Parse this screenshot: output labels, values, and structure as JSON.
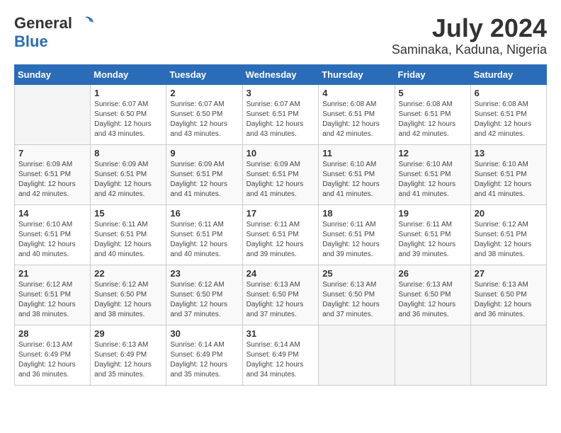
{
  "header": {
    "logo_general": "General",
    "logo_blue": "Blue",
    "title": "July 2024",
    "subtitle": "Saminaka, Kaduna, Nigeria"
  },
  "calendar": {
    "days_of_week": [
      "Sunday",
      "Monday",
      "Tuesday",
      "Wednesday",
      "Thursday",
      "Friday",
      "Saturday"
    ],
    "weeks": [
      [
        {
          "day": "",
          "sunrise": "",
          "sunset": "",
          "daylight": ""
        },
        {
          "day": "1",
          "sunrise": "Sunrise: 6:07 AM",
          "sunset": "Sunset: 6:50 PM",
          "daylight": "Daylight: 12 hours and 43 minutes."
        },
        {
          "day": "2",
          "sunrise": "Sunrise: 6:07 AM",
          "sunset": "Sunset: 6:50 PM",
          "daylight": "Daylight: 12 hours and 43 minutes."
        },
        {
          "day": "3",
          "sunrise": "Sunrise: 6:07 AM",
          "sunset": "Sunset: 6:51 PM",
          "daylight": "Daylight: 12 hours and 43 minutes."
        },
        {
          "day": "4",
          "sunrise": "Sunrise: 6:08 AM",
          "sunset": "Sunset: 6:51 PM",
          "daylight": "Daylight: 12 hours and 42 minutes."
        },
        {
          "day": "5",
          "sunrise": "Sunrise: 6:08 AM",
          "sunset": "Sunset: 6:51 PM",
          "daylight": "Daylight: 12 hours and 42 minutes."
        },
        {
          "day": "6",
          "sunrise": "Sunrise: 6:08 AM",
          "sunset": "Sunset: 6:51 PM",
          "daylight": "Daylight: 12 hours and 42 minutes."
        }
      ],
      [
        {
          "day": "7",
          "sunrise": "Sunrise: 6:09 AM",
          "sunset": "Sunset: 6:51 PM",
          "daylight": "Daylight: 12 hours and 42 minutes."
        },
        {
          "day": "8",
          "sunrise": "Sunrise: 6:09 AM",
          "sunset": "Sunset: 6:51 PM",
          "daylight": "Daylight: 12 hours and 42 minutes."
        },
        {
          "day": "9",
          "sunrise": "Sunrise: 6:09 AM",
          "sunset": "Sunset: 6:51 PM",
          "daylight": "Daylight: 12 hours and 41 minutes."
        },
        {
          "day": "10",
          "sunrise": "Sunrise: 6:09 AM",
          "sunset": "Sunset: 6:51 PM",
          "daylight": "Daylight: 12 hours and 41 minutes."
        },
        {
          "day": "11",
          "sunrise": "Sunrise: 6:10 AM",
          "sunset": "Sunset: 6:51 PM",
          "daylight": "Daylight: 12 hours and 41 minutes."
        },
        {
          "day": "12",
          "sunrise": "Sunrise: 6:10 AM",
          "sunset": "Sunset: 6:51 PM",
          "daylight": "Daylight: 12 hours and 41 minutes."
        },
        {
          "day": "13",
          "sunrise": "Sunrise: 6:10 AM",
          "sunset": "Sunset: 6:51 PM",
          "daylight": "Daylight: 12 hours and 41 minutes."
        }
      ],
      [
        {
          "day": "14",
          "sunrise": "Sunrise: 6:10 AM",
          "sunset": "Sunset: 6:51 PM",
          "daylight": "Daylight: 12 hours and 40 minutes."
        },
        {
          "day": "15",
          "sunrise": "Sunrise: 6:11 AM",
          "sunset": "Sunset: 6:51 PM",
          "daylight": "Daylight: 12 hours and 40 minutes."
        },
        {
          "day": "16",
          "sunrise": "Sunrise: 6:11 AM",
          "sunset": "Sunset: 6:51 PM",
          "daylight": "Daylight: 12 hours and 40 minutes."
        },
        {
          "day": "17",
          "sunrise": "Sunrise: 6:11 AM",
          "sunset": "Sunset: 6:51 PM",
          "daylight": "Daylight: 12 hours and 39 minutes."
        },
        {
          "day": "18",
          "sunrise": "Sunrise: 6:11 AM",
          "sunset": "Sunset: 6:51 PM",
          "daylight": "Daylight: 12 hours and 39 minutes."
        },
        {
          "day": "19",
          "sunrise": "Sunrise: 6:11 AM",
          "sunset": "Sunset: 6:51 PM",
          "daylight": "Daylight: 12 hours and 39 minutes."
        },
        {
          "day": "20",
          "sunrise": "Sunrise: 6:12 AM",
          "sunset": "Sunset: 6:51 PM",
          "daylight": "Daylight: 12 hours and 38 minutes."
        }
      ],
      [
        {
          "day": "21",
          "sunrise": "Sunrise: 6:12 AM",
          "sunset": "Sunset: 6:51 PM",
          "daylight": "Daylight: 12 hours and 38 minutes."
        },
        {
          "day": "22",
          "sunrise": "Sunrise: 6:12 AM",
          "sunset": "Sunset: 6:50 PM",
          "daylight": "Daylight: 12 hours and 38 minutes."
        },
        {
          "day": "23",
          "sunrise": "Sunrise: 6:12 AM",
          "sunset": "Sunset: 6:50 PM",
          "daylight": "Daylight: 12 hours and 37 minutes."
        },
        {
          "day": "24",
          "sunrise": "Sunrise: 6:13 AM",
          "sunset": "Sunset: 6:50 PM",
          "daylight": "Daylight: 12 hours and 37 minutes."
        },
        {
          "day": "25",
          "sunrise": "Sunrise: 6:13 AM",
          "sunset": "Sunset: 6:50 PM",
          "daylight": "Daylight: 12 hours and 37 minutes."
        },
        {
          "day": "26",
          "sunrise": "Sunrise: 6:13 AM",
          "sunset": "Sunset: 6:50 PM",
          "daylight": "Daylight: 12 hours and 36 minutes."
        },
        {
          "day": "27",
          "sunrise": "Sunrise: 6:13 AM",
          "sunset": "Sunset: 6:50 PM",
          "daylight": "Daylight: 12 hours and 36 minutes."
        }
      ],
      [
        {
          "day": "28",
          "sunrise": "Sunrise: 6:13 AM",
          "sunset": "Sunset: 6:49 PM",
          "daylight": "Daylight: 12 hours and 36 minutes."
        },
        {
          "day": "29",
          "sunrise": "Sunrise: 6:13 AM",
          "sunset": "Sunset: 6:49 PM",
          "daylight": "Daylight: 12 hours and 35 minutes."
        },
        {
          "day": "30",
          "sunrise": "Sunrise: 6:14 AM",
          "sunset": "Sunset: 6:49 PM",
          "daylight": "Daylight: 12 hours and 35 minutes."
        },
        {
          "day": "31",
          "sunrise": "Sunrise: 6:14 AM",
          "sunset": "Sunset: 6:49 PM",
          "daylight": "Daylight: 12 hours and 34 minutes."
        },
        {
          "day": "",
          "sunrise": "",
          "sunset": "",
          "daylight": ""
        },
        {
          "day": "",
          "sunrise": "",
          "sunset": "",
          "daylight": ""
        },
        {
          "day": "",
          "sunrise": "",
          "sunset": "",
          "daylight": ""
        }
      ]
    ]
  }
}
